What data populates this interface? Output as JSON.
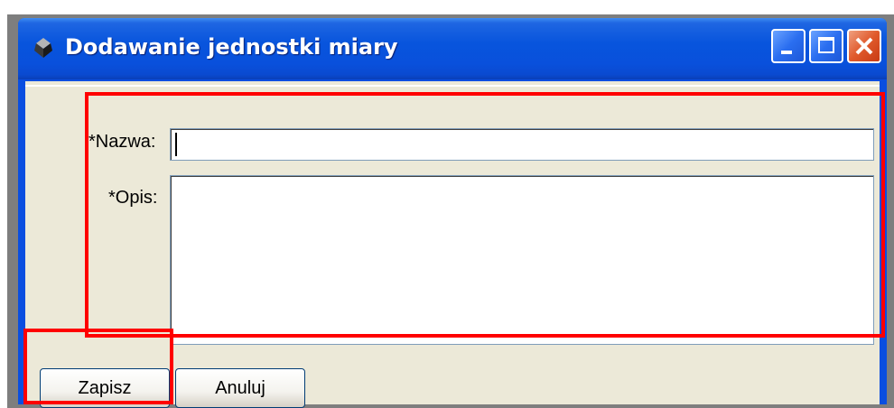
{
  "window": {
    "title": "Dodawanie jednostki miary",
    "app_icon": "dark-gem-icon",
    "controls": [
      "minimize-icon",
      "maximize-icon",
      "close-icon"
    ]
  },
  "form": {
    "name_label": "*Nazwa:",
    "name_value": "",
    "description_label": "*Opis:",
    "description_value": ""
  },
  "buttons": {
    "save_label": "Zapisz",
    "cancel_label": "Anuluj"
  },
  "colors": {
    "titlebar": "#0855dd",
    "client_background": "#ece9d8",
    "highlight": "#ff0000"
  }
}
